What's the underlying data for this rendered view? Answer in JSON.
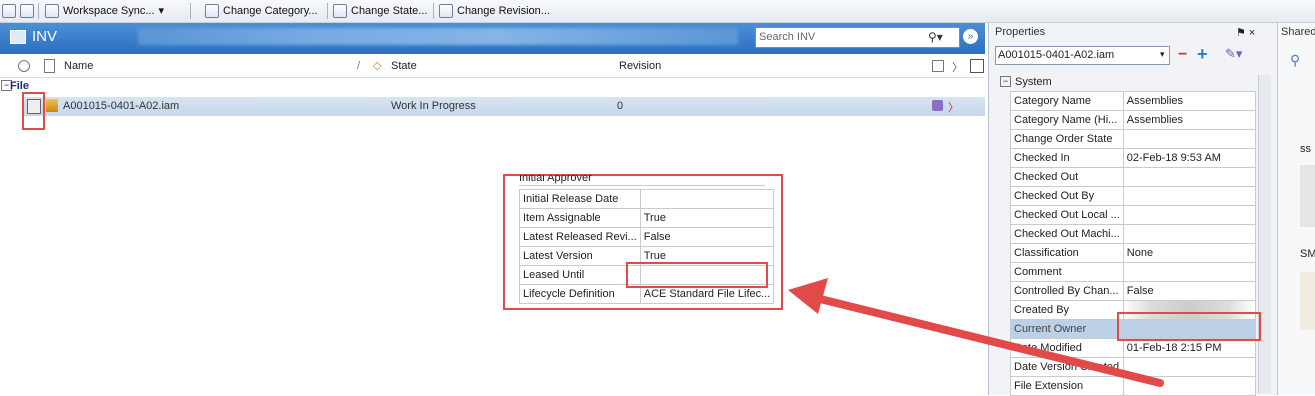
{
  "toolbar": {
    "workspace_sync": "Workspace Sync...",
    "change_category": "Change Category...",
    "change_state": "Change State...",
    "change_revision": "Change Revision..."
  },
  "vault": {
    "title": "INV",
    "search_placeholder": "Search INV",
    "columns": {
      "name": "Name",
      "state": "State",
      "revision": "Revision"
    },
    "group": "File",
    "row": {
      "name": "A001015-0401-A02.iam",
      "state": "Work In Progress",
      "revision": "0"
    }
  },
  "popup": {
    "partial_top": "Initial Approver",
    "rows": [
      {
        "k": "Initial Release Date",
        "v": ""
      },
      {
        "k": "Item Assignable",
        "v": "True"
      },
      {
        "k": "Latest Released Revi...",
        "v": "False"
      },
      {
        "k": "Latest Version",
        "v": "True"
      },
      {
        "k": "Leased Until",
        "v": ""
      },
      {
        "k": "Lifecycle Definition",
        "v": "ACE Standard File Lifec..."
      }
    ]
  },
  "properties": {
    "title": "Properties",
    "pin": "⚑ ×",
    "file": "A001015-0401-A02.iam",
    "section": "System",
    "rows": [
      {
        "k": "Category Name",
        "v": "Assemblies"
      },
      {
        "k": "Category Name (Hi...",
        "v": "Assemblies"
      },
      {
        "k": "Change Order State",
        "v": ""
      },
      {
        "k": "Checked In",
        "v": "02-Feb-18 9:53 AM"
      },
      {
        "k": "Checked Out",
        "v": ""
      },
      {
        "k": "Checked Out By",
        "v": ""
      },
      {
        "k": "Checked Out Local ...",
        "v": ""
      },
      {
        "k": "Checked Out Machi...",
        "v": ""
      },
      {
        "k": "Classification",
        "v": "None"
      },
      {
        "k": "Comment",
        "v": ""
      },
      {
        "k": "Controlled By Chan...",
        "v": "False"
      },
      {
        "k": "Created By",
        "v": ""
      },
      {
        "k": "Current Owner",
        "v": ""
      },
      {
        "k": "Date Modified",
        "v": "01-Feb-18 2:15 PM"
      },
      {
        "k": "Date Version Created",
        "v": ""
      },
      {
        "k": "File Extension",
        "v": ""
      }
    ]
  },
  "shared": {
    "title": "Shared",
    "t1": "ss",
    "t2": "SM"
  },
  "colors": {
    "header_blue": "#2a6fc1",
    "highlight_red": "#e24a4a",
    "row_select": "#c5d7ea"
  }
}
